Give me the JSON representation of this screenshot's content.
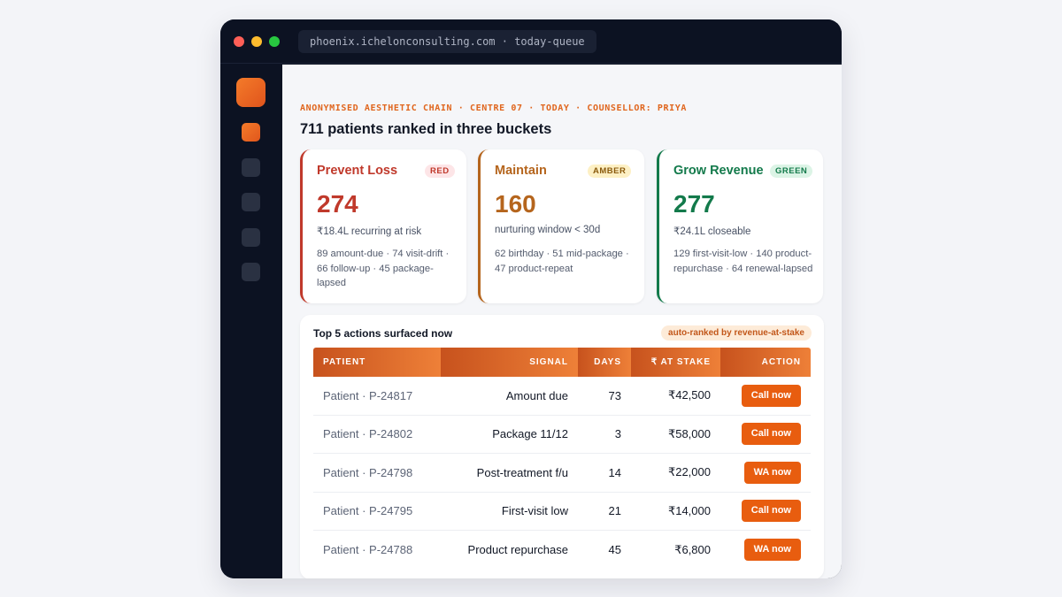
{
  "window": {
    "url": "phoenix.ichelonconsulting.com · today-queue"
  },
  "header": {
    "eyebrow": "ANONYMISED AESTHETIC CHAIN · CENTRE 07 · TODAY · COUNSELLOR: PRIYA",
    "title": "711 patients ranked in three buckets"
  },
  "cards": [
    {
      "title": "Prevent Loss",
      "badge": "RED",
      "value": "274",
      "subtitle": "₹18.4L recurring at risk",
      "description": "89 amount-due · 74 visit-drift · 66 follow-up · 45 package-lapsed",
      "color": "#c0392b"
    },
    {
      "title": "Maintain",
      "badge": "AMBER",
      "value": "160",
      "subtitle": "nurturing window < 30d",
      "description": "62 birthday · 51 mid-package · 47 product-repeat",
      "color": "#b5651d"
    },
    {
      "title": "Grow Revenue",
      "badge": "GREEN",
      "value": "277",
      "subtitle": "₹24.1L closeable",
      "description": "129 first-visit-low · 140 product-repurchase · 64 renewal-lapsed",
      "color": "#137a4b"
    }
  ],
  "table": {
    "title": "Top 5 actions surfaced now",
    "pill": "auto-ranked by revenue-at-stake",
    "columns": [
      "PATIENT",
      "SIGNAL",
      "DAYS",
      "₹ AT STAKE",
      "ACTION"
    ],
    "rows": [
      {
        "patient": "Patient · P-24817",
        "signal": "Amount due",
        "days": "73",
        "stake": "₹42,500",
        "action": "Call now"
      },
      {
        "patient": "Patient · P-24802",
        "signal": "Package 11/12",
        "days": "3",
        "stake": "₹58,000",
        "action": "Call now"
      },
      {
        "patient": "Patient · P-24798",
        "signal": "Post-treatment f/u",
        "days": "14",
        "stake": "₹22,000",
        "action": "WA now"
      },
      {
        "patient": "Patient · P-24795",
        "signal": "First-visit low",
        "days": "21",
        "stake": "₹14,000",
        "action": "Call now"
      },
      {
        "patient": "Patient · P-24788",
        "signal": "Product repurchase",
        "days": "45",
        "stake": "₹6,800",
        "action": "WA now"
      }
    ]
  },
  "colors": {
    "accent": "#e85d0f",
    "window_bg": "#0c1222"
  }
}
